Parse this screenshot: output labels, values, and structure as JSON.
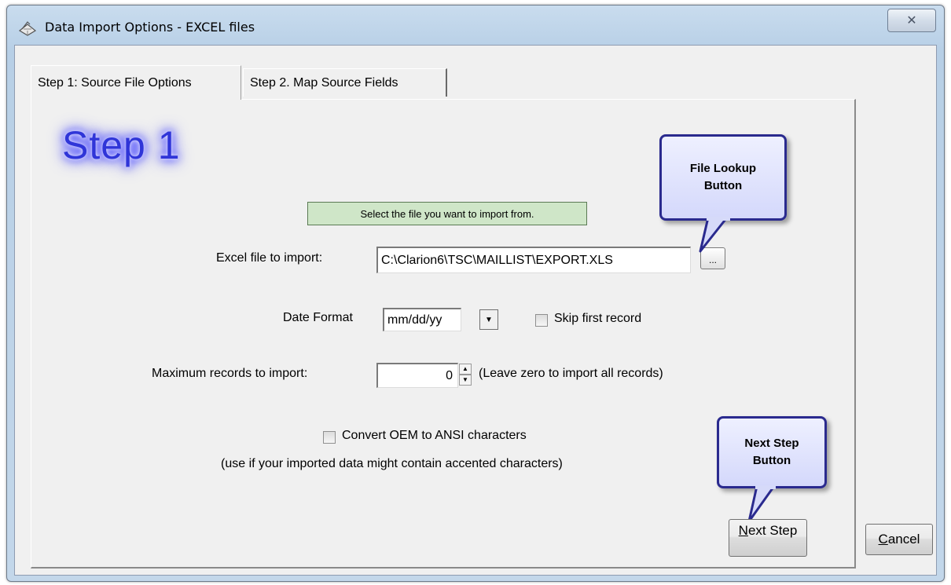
{
  "window": {
    "title": "Data Import Options - EXCEL files",
    "close_glyph": "✕"
  },
  "tabs": [
    {
      "label": "Step 1: Source File Options",
      "active": true
    },
    {
      "label": "Step 2. Map Source Fields",
      "active": false
    }
  ],
  "step_badge": "Step 1",
  "hint": "Select the file you want to import from.",
  "file": {
    "label": "Excel file to import:",
    "value": "C:\\Clarion6\\TSC\\MAILLIST\\EXPORT.XLS",
    "lookup_label": "..."
  },
  "date_format": {
    "label": "Date Format",
    "value": "mm/dd/yy",
    "arrow": "▼"
  },
  "skip_first": {
    "label": "Skip first record",
    "checked": false
  },
  "max_records": {
    "label": "Maximum records to import:",
    "value": "0",
    "note": "(Leave zero to import all records)",
    "up": "▲",
    "down": "▼"
  },
  "convert_oem": {
    "label": "Convert OEM to ANSI characters",
    "checked": false,
    "note": "(use if your imported data might contain accented characters)"
  },
  "callouts": {
    "file_lookup": [
      "File Lookup",
      "Button"
    ],
    "next_step": [
      "Next Step",
      "Button"
    ]
  },
  "buttons": {
    "next_step_mnemonic": "N",
    "next_step_rest": "ext Step",
    "cancel_mnemonic": "C",
    "cancel_rest": "ancel"
  },
  "colors": {
    "hint_bg": "#cfe6c8",
    "callout_border": "#2a2a8e",
    "step_badge": "#2f35d8"
  }
}
